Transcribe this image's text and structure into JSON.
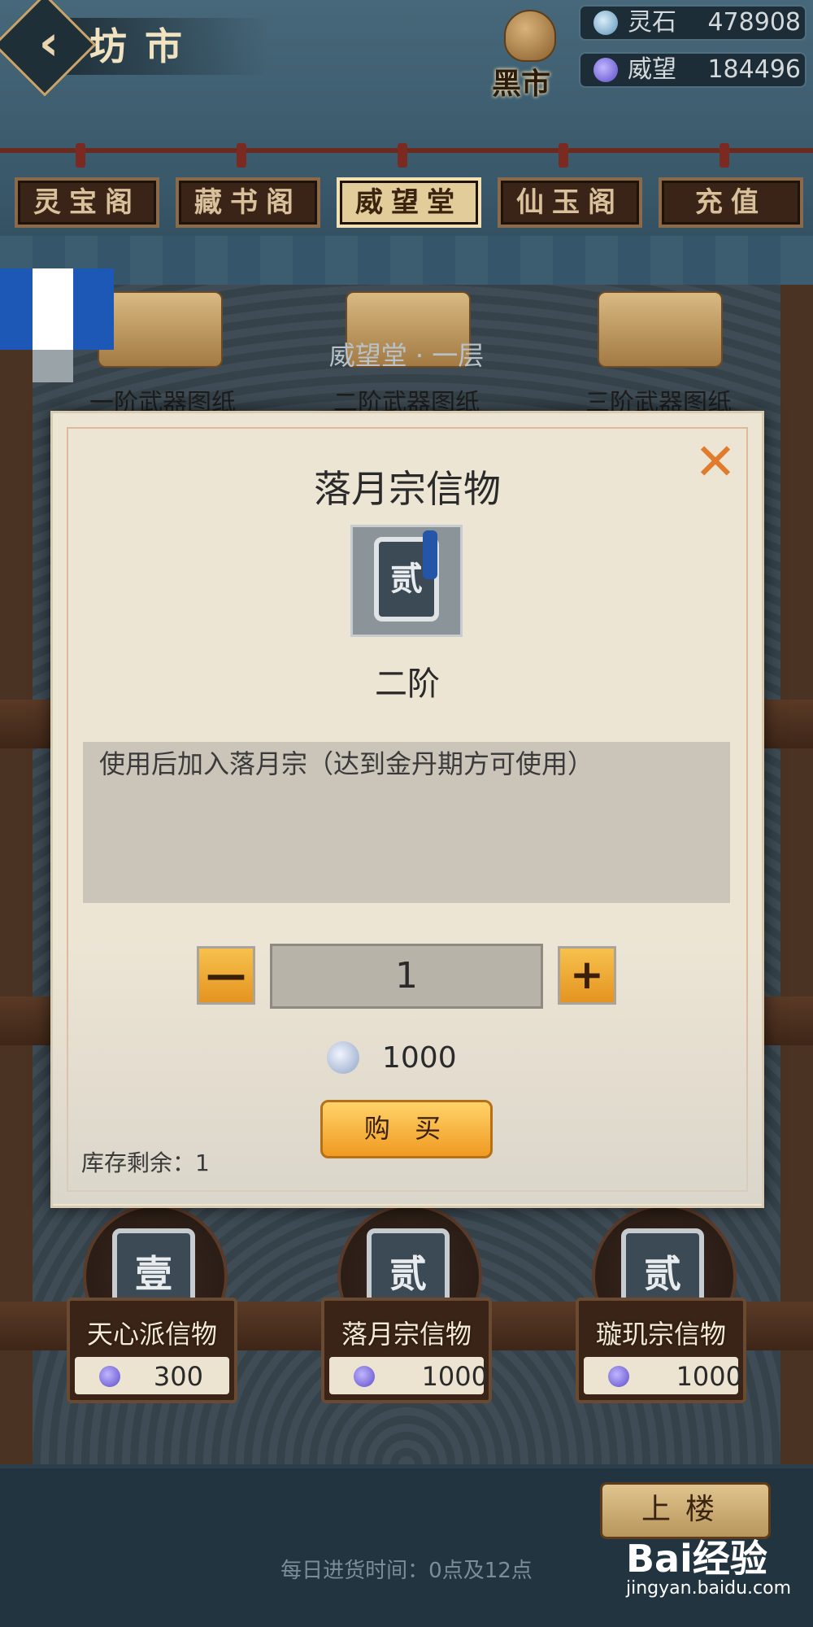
{
  "header": {
    "title": "坊市",
    "black_market_label": "黑市",
    "currencies": [
      {
        "name": "灵石",
        "value": "478908",
        "icon": "spirit-stone-icon",
        "color": "#7fb4d6"
      },
      {
        "name": "威望",
        "value": "184496",
        "icon": "prestige-icon",
        "color": "#8c7ee0"
      }
    ]
  },
  "tabs": [
    {
      "label": "灵宝阁",
      "active": false
    },
    {
      "label": "藏书阁",
      "active": false
    },
    {
      "label": "威望堂",
      "active": true
    },
    {
      "label": "仙玉阁",
      "active": false
    },
    {
      "label": "充值",
      "active": false
    }
  ],
  "shop": {
    "floor_title": "威望堂 · 一层",
    "top_row_items": [
      "一阶武器图纸",
      "二阶武器图纸",
      "三阶武器图纸"
    ],
    "bottom_row_items": [
      {
        "name": "天心派信物",
        "glyph": "壹",
        "price": "300"
      },
      {
        "name": "落月宗信物",
        "glyph": "贰",
        "price": "1000"
      },
      {
        "name": "璇玑宗信物",
        "glyph": "贰",
        "price": "1000"
      }
    ],
    "go_upstairs": "上楼",
    "restock_info": "每日进货时间：0点及12点"
  },
  "modal": {
    "title": "落月宗信物",
    "item_glyph": "贰",
    "grade": "二阶",
    "description": "使用后加入落月宗（达到金丹期方可使用）",
    "decrease": "—",
    "increase": "+",
    "quantity": "1",
    "price": "1000",
    "buy_label": "购 买",
    "stock": "库存剩余：1",
    "close": "✕"
  },
  "watermark": {
    "brand": "Bai经验",
    "url": "jingyan.baidu.com"
  },
  "colors": {
    "accent_orange": "#f09a22",
    "close_orange": "#e07c2c",
    "modal_bg": "#ede5d4"
  }
}
